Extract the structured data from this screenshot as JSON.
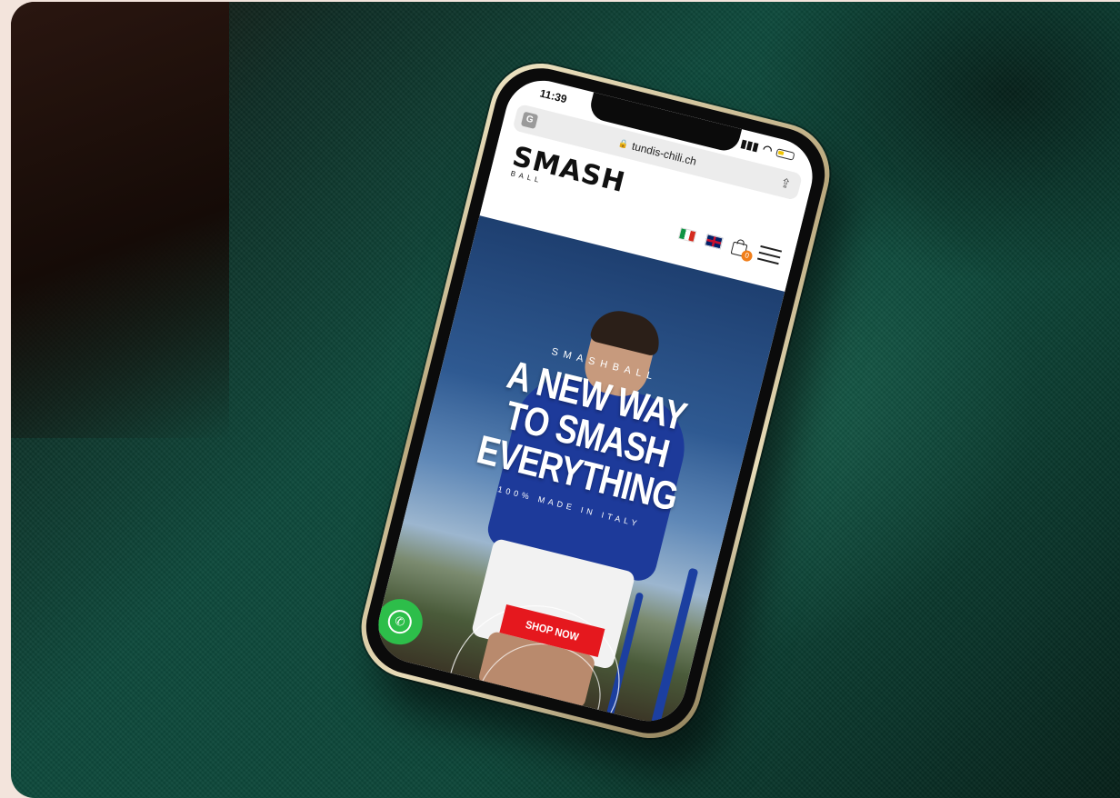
{
  "status_bar": {
    "time": "11:39"
  },
  "browser": {
    "url": "tundis-chili.ch",
    "translate_icon": "translate-icon",
    "share_icon": "share-icon"
  },
  "header": {
    "logo_main": "SMASH",
    "logo_sub": "BALL",
    "cart_count": "0",
    "icons": [
      "flag-italy-icon",
      "flag-uk-icon",
      "cart-icon",
      "hamburger-menu-icon"
    ]
  },
  "hero": {
    "eyebrow": "SMASHBALL",
    "title_line1": "A NEW WAY",
    "title_line2": "TO SMASH",
    "title_line3": "EVERYTHING",
    "subtitle": "100% MADE IN ITALY",
    "cta_label": "SHOP NOW"
  },
  "floating": {
    "whatsapp_icon": "whatsapp-icon"
  },
  "colors": {
    "cta": "#e5181e",
    "whatsapp": "#2dbe4a",
    "badge": "#f07e1a",
    "fabric": "#0e4a3c"
  }
}
